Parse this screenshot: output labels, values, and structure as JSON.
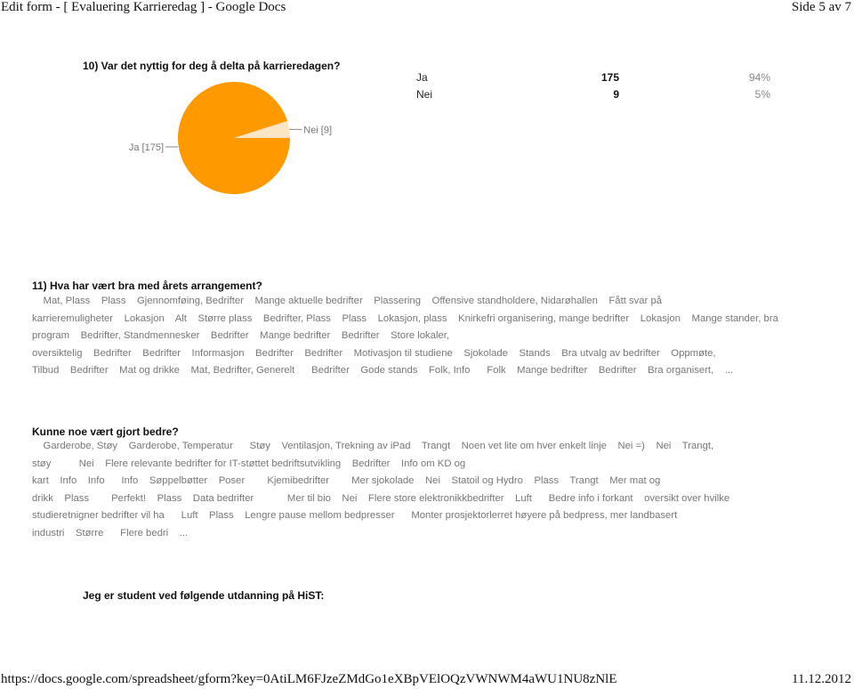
{
  "header": {
    "title": "Edit form - [ Evaluering Karrieredag ] - Google Docs",
    "page_indicator": "Side 5 av 7"
  },
  "question10": {
    "title": "10) Var det nyttig for deg å delta på karrieredagen?",
    "summary": [
      {
        "label": "Ja",
        "count": "175",
        "percent": "94%"
      },
      {
        "label": "Nei",
        "count": "9",
        "percent": "5%"
      }
    ],
    "pie_labels": {
      "ja": "Ja [175]",
      "nei": "Nei [9]"
    }
  },
  "chart_data": {
    "type": "pie",
    "title": "10) Var det nyttig for deg å delta på karrieredagen?",
    "categories": [
      "Ja",
      "Nei"
    ],
    "values": [
      175,
      9
    ],
    "percentages": [
      94,
      5
    ],
    "colors": [
      "#ff9900",
      "#fce5c4"
    ],
    "labels": [
      "Ja [175]",
      "Nei [9]"
    ]
  },
  "question11": {
    "title": "11) Hva har vært bra med årets arrangement?",
    "answer_lines": [
      "    Mat, Plass    Plass    Gjennomføing, Bedrifter    Mange aktuelle bedrifter    Plassering    Offensive standholdere, Nidarøhallen    Fått svar på",
      "karrieremuligheter    Lokasjon    Alt    Større plass    Bedrifter, Plass    Plass    Lokasjon, plass    Knirkefri organisering, mange bedrifter    Lokasjon    Mange stander, bra",
      "program    Bedrifter, Standmennesker    Bedrifter    Mange bedrifter    Bedrifter    Store lokaler,",
      "oversiktelig    Bedrifter    Bedrifter    Informasjon    Bedrifter    Bedrifter    Motivasjon til studiene    Sjokolade    Stands    Bra utvalg av bedrifter    Oppmøte,",
      "Tilbud    Bedrifter    Mat og drikke    Mat, Bedrifter, Generelt      Bedrifter    Gode stands    Folk, Info      Folk    Mange bedrifter    Bedrifter    Bra organisert,    ..."
    ]
  },
  "question_improve": {
    "title": "Kunne noe vært gjort bedre?",
    "answer_lines": [
      "    Garderobe, Støy    Garderobe, Temperatur      Støy    Ventilasjon, Trekning av iPad    Trangt    Noen vet lite om hver enkelt linje    Nei =)    Nei    Trangt,",
      "støy          Nei    Flere relevante bedrifter for IT-støttet bedriftsutvikling    Bedrifter    Info om KD og",
      "kart    Info    Info      Info    Søppelbøtter    Poser        Kjemibedrifter        Mer sjokolade    Nei    Statoil og Hydro    Plass    Trangt    Mer mat og",
      "drikk    Plass        Perfekt!    Plass    Data bedrifter            Mer til bio    Nei    Flere store elektronikkbedrifter    Luft      Bedre info i forkant    oversikt over hvilke",
      "studieretnigner bedrifter vil ha      Luft    Plass    Lengre pause mellom bedpresser      Monter prosjektorlerret høyere på bedpress, mer landbasert",
      "industri    Større      Flere bedri    ..."
    ]
  },
  "question_student": {
    "title": "Jeg er student ved følgende utdanning på HiST:"
  },
  "footer": {
    "url": "https://docs.google.com/spreadsheet/gform?key=0AtiLM6FJzeZMdGo1eXBpVElOQzVWNWM4aWU1NU8zNlE",
    "date": "11.12.2012"
  }
}
